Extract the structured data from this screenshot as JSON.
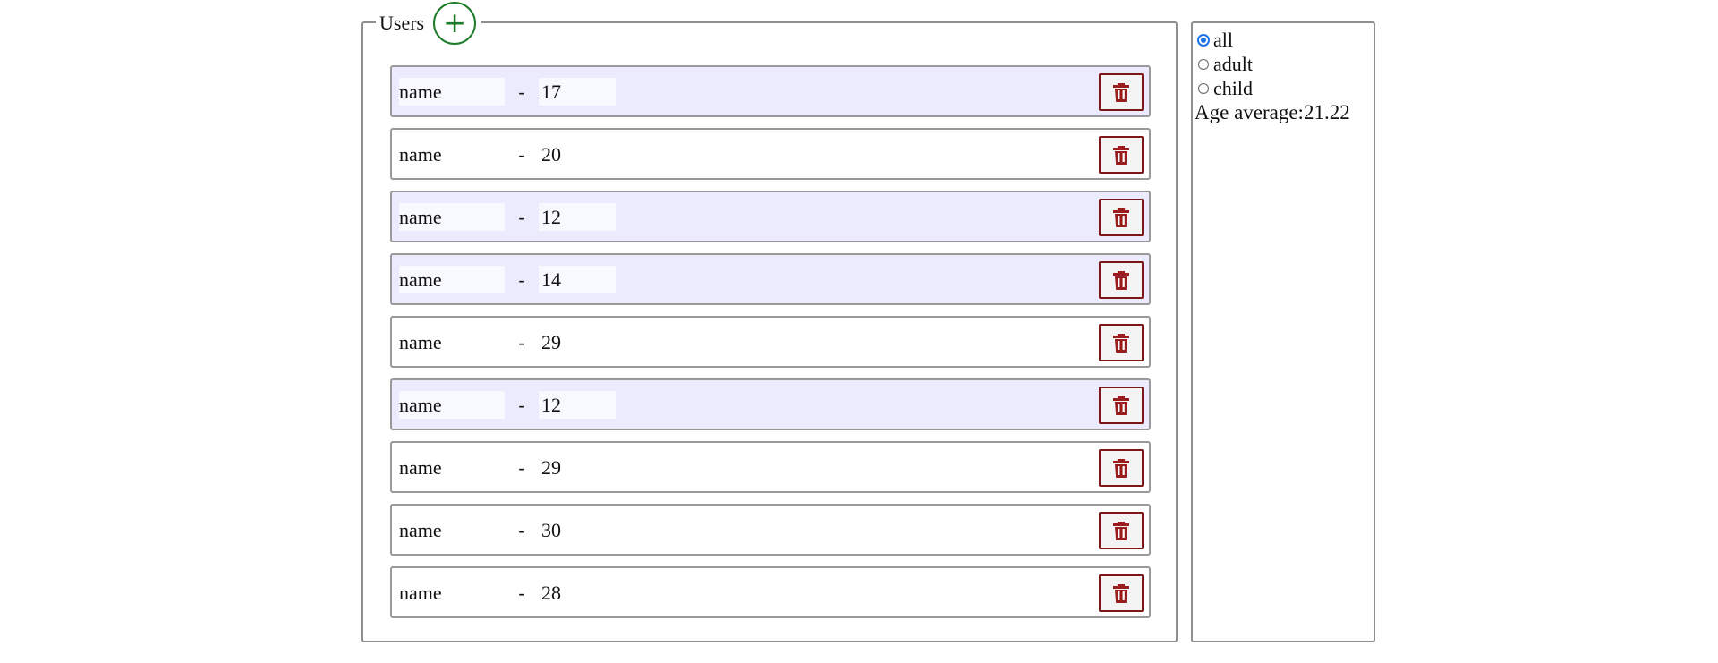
{
  "users_panel": {
    "title": "Users",
    "add_button_symbol": "+",
    "users": [
      {
        "name": "name",
        "separator": "-",
        "age": "17",
        "highlighted": true
      },
      {
        "name": "name",
        "separator": "-",
        "age": "20",
        "highlighted": false
      },
      {
        "name": "name",
        "separator": "-",
        "age": "12",
        "highlighted": true
      },
      {
        "name": "name",
        "separator": "-",
        "age": "14",
        "highlighted": true
      },
      {
        "name": "name",
        "separator": "-",
        "age": "29",
        "highlighted": false
      },
      {
        "name": "name",
        "separator": "-",
        "age": "12",
        "highlighted": true
      },
      {
        "name": "name",
        "separator": "-",
        "age": "29",
        "highlighted": false
      },
      {
        "name": "name",
        "separator": "-",
        "age": "30",
        "highlighted": false
      },
      {
        "name": "name",
        "separator": "-",
        "age": "28",
        "highlighted": false
      }
    ],
    "delete_icon": "trash-icon"
  },
  "filter_panel": {
    "options": [
      {
        "label": "all",
        "checked": true
      },
      {
        "label": "adult",
        "checked": false
      },
      {
        "label": "child",
        "checked": false
      }
    ],
    "average_label": "Age average:",
    "average_value": "21.22"
  },
  "colors": {
    "add_button": "#1d7b2a",
    "delete_button": "#7d1616",
    "highlight_row": "#ebebfd",
    "selected_radio": "#1a73e8"
  }
}
